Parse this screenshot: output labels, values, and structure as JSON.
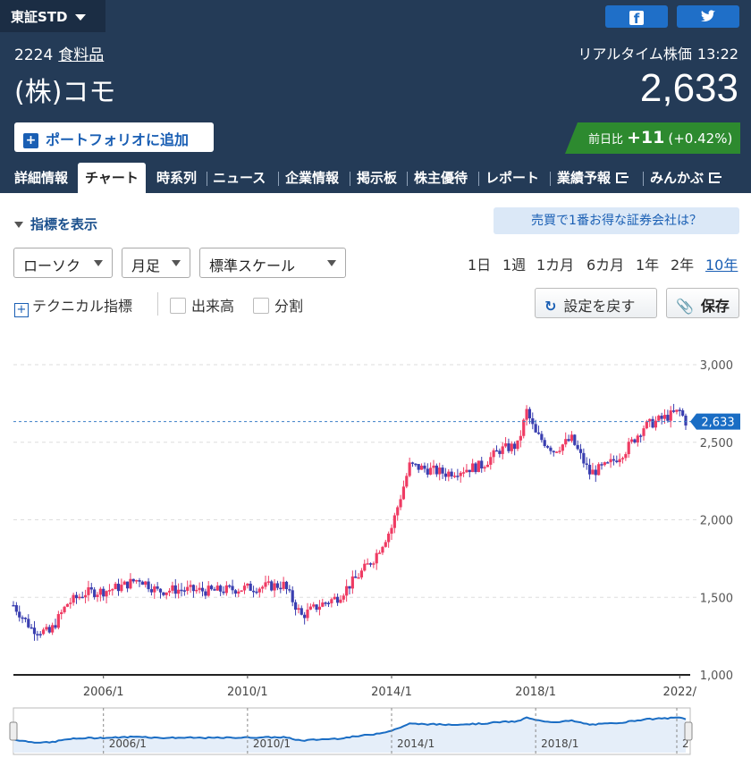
{
  "market": {
    "label": "東証STD"
  },
  "share": {
    "facebook": "f",
    "twitter": "t"
  },
  "stock": {
    "code": "2224",
    "industry": "食料品",
    "name": "(株)コモ",
    "price": "2,633",
    "realtime_label": "リアルタイム株価",
    "time": "13:22"
  },
  "portfolio": {
    "plus": "+",
    "label": "ポートフォリオに追加"
  },
  "change": {
    "label": "前日比",
    "value": "+11",
    "percent": "(+0.42%)"
  },
  "nav": {
    "items": [
      {
        "label": "詳細情報"
      },
      {
        "label": "チャート"
      },
      {
        "label": "時系列"
      },
      {
        "label": "ニュース"
      },
      {
        "label": "企業情報"
      },
      {
        "label": "掲示板"
      },
      {
        "label": "株主優待"
      },
      {
        "label": "レポート"
      },
      {
        "label": "業績予報"
      },
      {
        "label": "みんかぶ"
      }
    ]
  },
  "toolbar": {
    "show_indicators": "指標を表示",
    "promo": "売買で1番お得な証券会社は？",
    "chart_type": "ローソク",
    "period": "月足",
    "scale": "標準スケール",
    "ranges": [
      "1日",
      "1週",
      "1カ月",
      "6カ月",
      "1年",
      "2年",
      "10年"
    ],
    "active_range": "10年",
    "technical": "テクニカル指標",
    "volume": "出来高",
    "split": "分割",
    "reset": "設定を戻す",
    "save": "保存"
  },
  "colors": {
    "up": "#ef3b63",
    "down": "#3a3fb0",
    "header": "#243b57",
    "accent": "#1a5fb4",
    "change_bg": "#2d8a2f"
  },
  "chart_data": {
    "type": "candlestick",
    "period": "monthly",
    "x_ticks": [
      "2006/1",
      "2010/1",
      "2014/1",
      "2018/1",
      "2022/"
    ],
    "y_ticks": [
      "3,000",
      "2,500",
      "2,000",
      "1,500",
      "1,000"
    ],
    "ylim": [
      1000,
      3000
    ],
    "current_price_label": "2,633",
    "current_price": 2633,
    "closes": [
      {
        "x": "2003/07",
        "y": 1450
      },
      {
        "x": "2004/01",
        "y": 1300
      },
      {
        "x": "2004/07",
        "y": 1270
      },
      {
        "x": "2005/01",
        "y": 1460
      },
      {
        "x": "2005/07",
        "y": 1530
      },
      {
        "x": "2006/01",
        "y": 1540
      },
      {
        "x": "2006/07",
        "y": 1570
      },
      {
        "x": "2007/01",
        "y": 1620
      },
      {
        "x": "2007/07",
        "y": 1540
      },
      {
        "x": "2008/01",
        "y": 1550
      },
      {
        "x": "2009/01",
        "y": 1540
      },
      {
        "x": "2010/01",
        "y": 1560
      },
      {
        "x": "2011/01",
        "y": 1580
      },
      {
        "x": "2011/07",
        "y": 1380
      },
      {
        "x": "2012/01",
        "y": 1450
      },
      {
        "x": "2012/07",
        "y": 1500
      },
      {
        "x": "2013/01",
        "y": 1620
      },
      {
        "x": "2013/07",
        "y": 1750
      },
      {
        "x": "2014/01",
        "y": 1950
      },
      {
        "x": "2014/07",
        "y": 2350
      },
      {
        "x": "2015/07",
        "y": 2300
      },
      {
        "x": "2016/07",
        "y": 2350
      },
      {
        "x": "2017/01",
        "y": 2450
      },
      {
        "x": "2017/07",
        "y": 2480
      },
      {
        "x": "2017/10",
        "y": 2700
      },
      {
        "x": "2018/01",
        "y": 2550
      },
      {
        "x": "2018/07",
        "y": 2450
      },
      {
        "x": "2019/01",
        "y": 2520
      },
      {
        "x": "2019/07",
        "y": 2300
      },
      {
        "x": "2020/01",
        "y": 2350
      },
      {
        "x": "2020/07",
        "y": 2450
      },
      {
        "x": "2021/01",
        "y": 2600
      },
      {
        "x": "2021/07",
        "y": 2650
      },
      {
        "x": "2022/01",
        "y": 2700
      },
      {
        "x": "2022/03",
        "y": 2633
      }
    ],
    "navigator_ticks": [
      "2006/1",
      "2010/1",
      "2014/1",
      "2018/1",
      "2"
    ]
  }
}
